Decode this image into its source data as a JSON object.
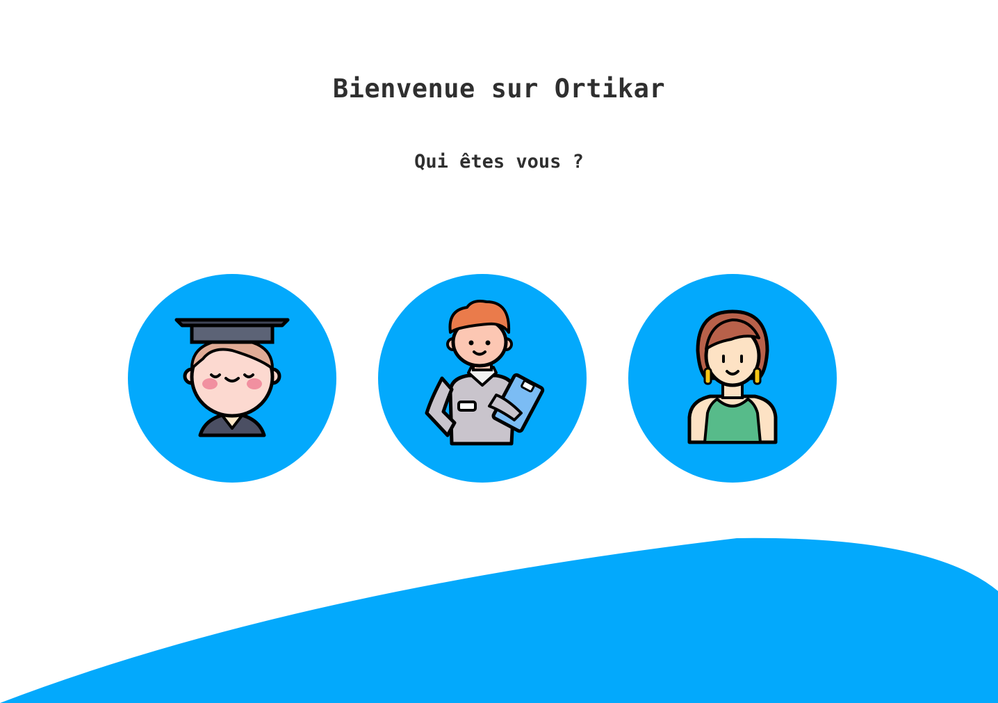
{
  "page": {
    "title": "Bienvenue sur Ortikar",
    "question": "Qui êtes vous ?"
  },
  "roles": [
    {
      "icon": "graduate-student-icon"
    },
    {
      "icon": "mechanic-worker-icon"
    },
    {
      "icon": "woman-client-icon"
    }
  ],
  "colors": {
    "accent": "#03a9fc",
    "text": "#2f2f2f",
    "background": "#ffffff"
  }
}
